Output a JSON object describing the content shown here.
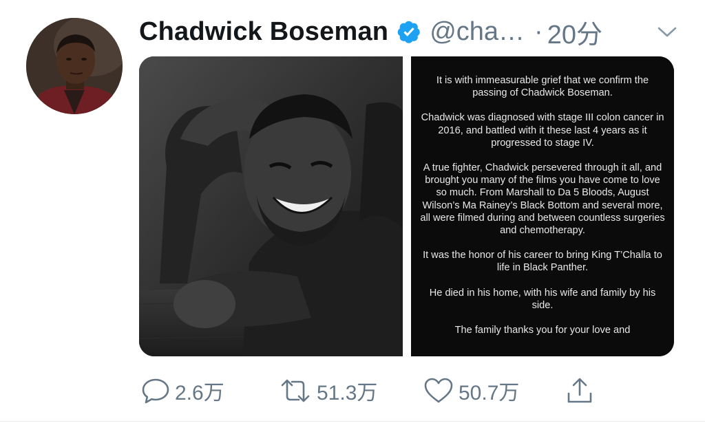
{
  "tweet": {
    "author": {
      "display_name": "Chadwick Boseman",
      "handle": "@cha…",
      "verified": true
    },
    "separator": "·",
    "timestamp": "20分",
    "media": {
      "statement_paragraphs": [
        "It is with immeasurable grief that we confirm the passing of Chadwick Boseman.",
        "Chadwick was diagnosed with stage III colon cancer in 2016, and battled with it these last 4 years as it progressed to stage IV.",
        "A true fighter, Chadwick persevered through it all, and brought you many of the films you have come to love so much. From Marshall to Da 5 Bloods, August Wilson’s Ma Rainey’s Black Bottom and several more, all were filmed during and between countless surgeries and chemotherapy.",
        "It was the honor of his career to bring King T’Challa to life in Black Panther.",
        "He died in his home, with his wife and family by his side.",
        "The family thanks you for your love and"
      ]
    },
    "actions": {
      "reply_count": "2.6万",
      "retweet_count": "51.3万",
      "like_count": "50.7万"
    }
  },
  "icons": {
    "verified": "verified-badge-icon",
    "caret": "chevron-down-icon",
    "reply": "reply-icon",
    "retweet": "retweet-icon",
    "like": "heart-icon",
    "share": "share-icon"
  },
  "colors": {
    "verified_blue": "#1da1f2",
    "secondary_text": "#657786",
    "primary_text": "#14171a"
  }
}
